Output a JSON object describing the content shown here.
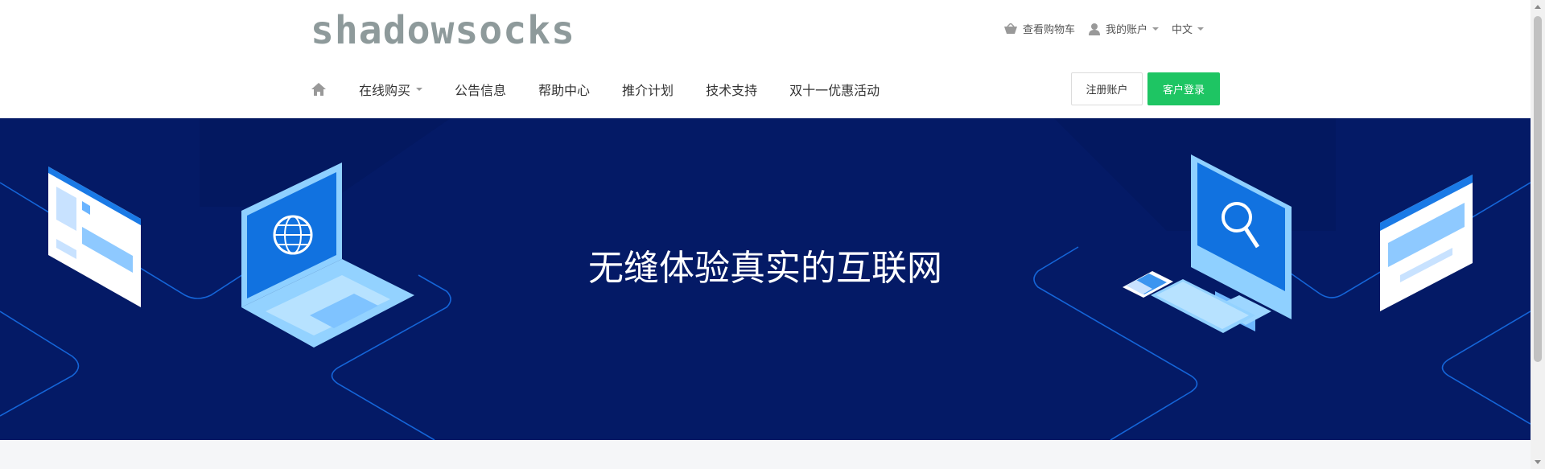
{
  "logo": {
    "text": "shadowsocks"
  },
  "topbar": {
    "cart_label": "查看购物车",
    "account_label": "我的账户",
    "language_label": "中文"
  },
  "nav": {
    "items": [
      {
        "label": "在线购买",
        "has_dropdown": true
      },
      {
        "label": "公告信息"
      },
      {
        "label": "帮助中心"
      },
      {
        "label": "推介计划"
      },
      {
        "label": "技术支持"
      },
      {
        "label": "双十一优惠活动"
      }
    ]
  },
  "buttons": {
    "register_label": "注册账户",
    "login_label": "客户登录"
  },
  "hero": {
    "title": "无缝体验真实的互联网"
  },
  "colors": {
    "hero_bg": "#041a66",
    "login_button": "#1ec563",
    "logo": "#8e9a9b",
    "accent_blue": "#1172e0"
  },
  "icons": [
    "basket-icon",
    "user-icon",
    "home-icon",
    "laptop-globe-icon",
    "desktop-search-icon"
  ]
}
